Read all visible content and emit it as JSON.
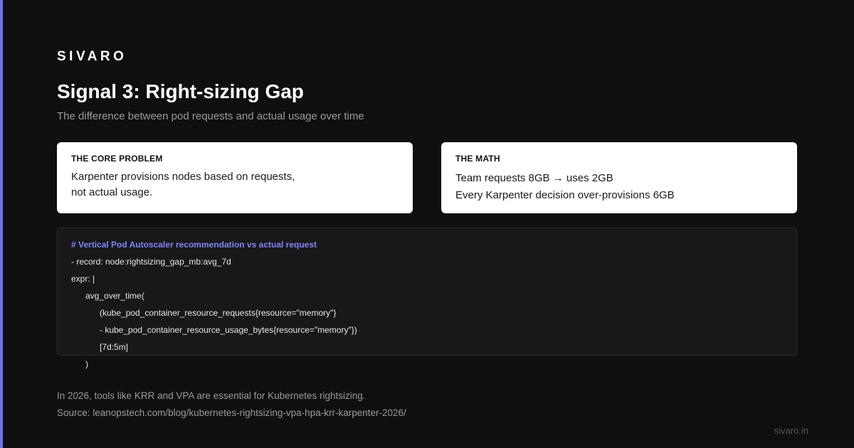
{
  "brand": "SIVARO",
  "title": "Signal 3: Right-sizing Gap",
  "subtitle": "The difference between pod requests and actual usage over time",
  "colors": {
    "accent": "#6b73f0",
    "background": "#0f0f10",
    "code_comment": "#7f86f2"
  },
  "cards": {
    "core_problem": {
      "heading": "THE CORE PROBLEM",
      "lines": [
        "Karpenter provisions nodes based on requests,",
        "not actual usage."
      ]
    },
    "math": {
      "heading": "THE MATH",
      "lines": [
        "Team requests 8GB → uses 2GB",
        "Every Karpenter decision over-provisions 6GB"
      ]
    }
  },
  "code": {
    "lines": [
      "# Vertical Pod Autoscaler recommendation vs actual request",
      "- record: node:rightsizing_gap_mb:avg_7d",
      "expr: |",
      "avg_over_time(",
      "(kube_pod_container_resource_requests{resource=\"memory\"}",
      "- kube_pod_container_resource_usage_bytes{resource=\"memory\"})",
      "[7d:5m]",
      ")"
    ]
  },
  "footer": {
    "note": "In 2026, tools like KRR and VPA are essential for Kubernetes rightsizing.",
    "source": "Source: leanopstech.com/blog/kubernetes-rightsizing-vpa-hpa-krr-karpenter-2026/"
  },
  "site_url": "sivaro.in"
}
